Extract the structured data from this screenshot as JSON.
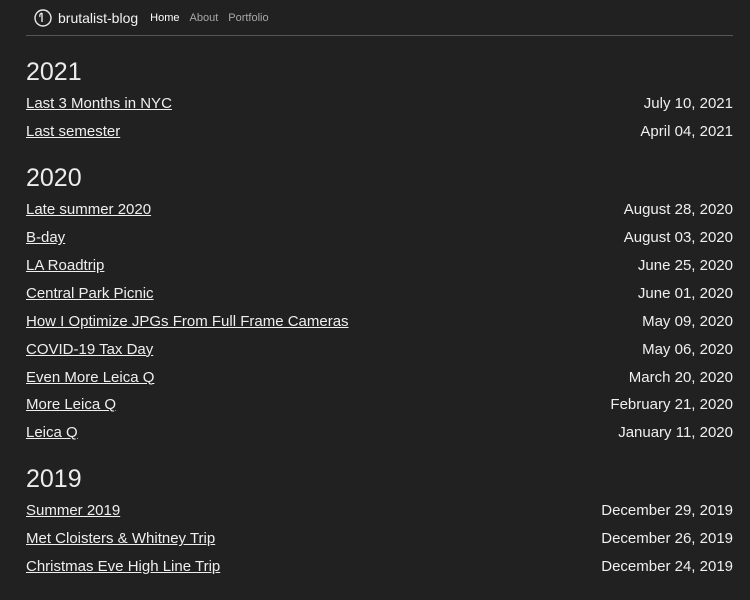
{
  "header": {
    "brand": "brutalist-blog",
    "nav": [
      {
        "label": "Home",
        "active": true
      },
      {
        "label": "About",
        "active": false
      },
      {
        "label": "Portfolio",
        "active": false
      }
    ],
    "logo_icon": "circle-logo-icon"
  },
  "years": [
    {
      "year": "2021",
      "posts": [
        {
          "title": "Last 3 Months in NYC",
          "date": "July 10, 2021"
        },
        {
          "title": "Last semester",
          "date": "April 04, 2021"
        }
      ]
    },
    {
      "year": "2020",
      "posts": [
        {
          "title": "Late summer 2020",
          "date": "August 28, 2020"
        },
        {
          "title": "B-day",
          "date": "August 03, 2020"
        },
        {
          "title": "LA Roadtrip",
          "date": "June 25, 2020"
        },
        {
          "title": "Central Park Picnic",
          "date": "June 01, 2020"
        },
        {
          "title": "How I Optimize JPGs From Full Frame Cameras",
          "date": "May 09, 2020"
        },
        {
          "title": "COVID-19 Tax Day",
          "date": "May 06, 2020"
        },
        {
          "title": "Even More Leica Q",
          "date": "March 20, 2020"
        },
        {
          "title": "More Leica Q",
          "date": "February 21, 2020"
        },
        {
          "title": "Leica Q",
          "date": "January 11, 2020"
        }
      ]
    },
    {
      "year": "2019",
      "posts": [
        {
          "title": "Summer 2019",
          "date": "December 29, 2019"
        },
        {
          "title": "Met Cloisters & Whitney Trip",
          "date": "December 26, 2019"
        },
        {
          "title": "Christmas Eve High Line Trip",
          "date": "December 24, 2019"
        }
      ]
    }
  ],
  "colors": {
    "background": "#212121",
    "text": "#efefef",
    "nav_inactive": "#a8a8a8"
  }
}
